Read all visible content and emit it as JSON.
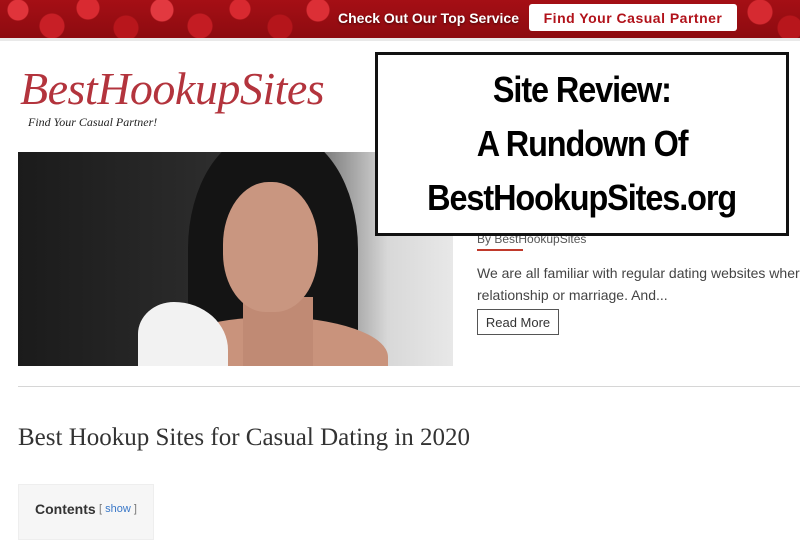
{
  "topbar": {
    "promo_text": "Check Out Our Top Service",
    "cta_label": "Find Your Casual Partner"
  },
  "site": {
    "logo": "BestHookupSites",
    "tagline": "Find Your Casual Partner!"
  },
  "overlay": {
    "line1": "Site Review:",
    "line2": "A Rundown Of",
    "line3": "BestHookupSites.org"
  },
  "post": {
    "byline": "By BestHookupSites",
    "excerpt_line1": "We are all familiar with regular dating websites where",
    "excerpt_line2": "relationship or marriage. And...",
    "read_more": "Read More"
  },
  "article": {
    "heading": "Best Hookup Sites for Casual Dating in 2020"
  },
  "toc": {
    "title": "Contents",
    "open_bracket": "[",
    "toggle": "show",
    "close_bracket": "]"
  },
  "colors": {
    "brand_red": "#b3343d",
    "banner_red": "#a50f15",
    "link_blue": "#3a78c8"
  }
}
